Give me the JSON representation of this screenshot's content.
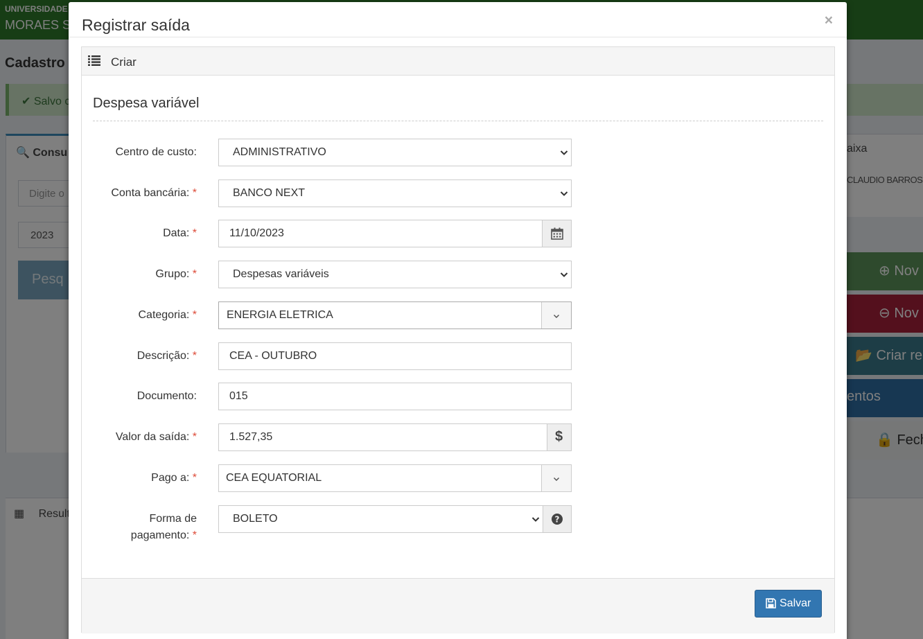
{
  "background": {
    "header_line1": "UNIVERSIDADE",
    "header_line2": "MORAES S",
    "page_title": "Cadastro",
    "alert_text": "Salvo c",
    "search_box_title": "Consu",
    "search_placeholder": "Digite o",
    "year_value": "2023",
    "search_button": "Pesq",
    "results_title": "Result",
    "right_box_title": "aixa",
    "right_box_user": "CLAUDIO BARROS",
    "btn_new_income": "Nov",
    "btn_new_expense": "Nov",
    "btn_create": "Criar re",
    "btn_documents": "entos",
    "btn_close": "Fech"
  },
  "modal": {
    "title": "Registrar saída",
    "close": "×",
    "panel_heading": "Criar",
    "section_title": "Despesa variável",
    "required_mark": "*",
    "fields": {
      "centro_custo": {
        "label": "Centro de custo:",
        "value": "ADMINISTRATIVO"
      },
      "conta_bancaria": {
        "label": "Conta bancária:",
        "value": "BANCO NEXT"
      },
      "data": {
        "label": "Data:",
        "value": "11/10/2023"
      },
      "grupo": {
        "label": "Grupo:",
        "value": "Despesas variáveis"
      },
      "categoria": {
        "label": "Categoria:",
        "value": "ENERGIA ELETRICA"
      },
      "descricao": {
        "label": "Descrição:",
        "value": "CEA - OUTUBRO"
      },
      "documento": {
        "label": "Documento:",
        "value": "015"
      },
      "valor": {
        "label": "Valor da saída:",
        "value": "1.527,35",
        "addon": "$"
      },
      "pago_a": {
        "label": "Pago a:",
        "value": "CEA EQUATORIAL"
      },
      "forma_pagamento": {
        "label_line1": "Forma de",
        "label_line2": "pagamento:",
        "value": "BOLETO"
      }
    },
    "save_button": "Salvar"
  },
  "colors": {
    "header_green": "#2f7a2a",
    "primary": "#3276b1",
    "required": "#dd4b39"
  }
}
